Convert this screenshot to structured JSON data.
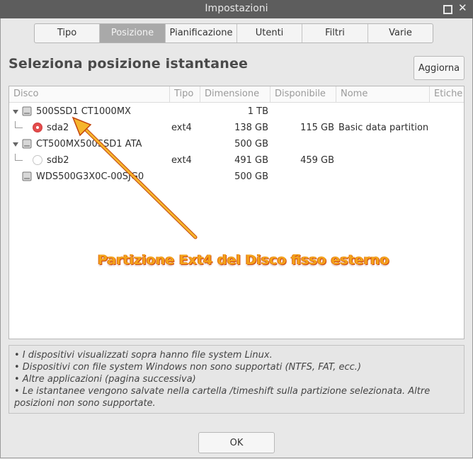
{
  "window": {
    "title": "Impostazioni"
  },
  "tabs": [
    {
      "label": "Tipo"
    },
    {
      "label": "Posizione"
    },
    {
      "label": "Pianificazione"
    },
    {
      "label": "Utenti"
    },
    {
      "label": "Filtri"
    },
    {
      "label": "Varie"
    }
  ],
  "active_tab": "Posizione",
  "heading": "Seleziona posizione istantanee",
  "refresh_button": "Aggiorna",
  "table": {
    "columns": [
      "Disco",
      "Tipo",
      "Dimensione",
      "Disponibile",
      "Nome",
      "Etiche"
    ],
    "rows": [
      {
        "disco": "500SSD1 CT1000MX",
        "tipo": "",
        "dimensione": "1 TB",
        "disponibile": "",
        "nome": "",
        "kind": "disk",
        "expanded": true
      },
      {
        "disco": "sda2",
        "tipo": "ext4",
        "dimensione": "138 GB",
        "disponibile": "115 GB",
        "nome": "Basic data partition",
        "kind": "partition",
        "selected": true
      },
      {
        "disco": "CT500MX500SSD1 ATA",
        "tipo": "",
        "dimensione": "500 GB",
        "disponibile": "",
        "nome": "",
        "kind": "disk",
        "expanded": true
      },
      {
        "disco": "sdb2",
        "tipo": "ext4",
        "dimensione": "491 GB",
        "disponibile": "459 GB",
        "nome": "",
        "kind": "partition",
        "selected": false
      },
      {
        "disco": "WDS500G3X0C-00SJG0",
        "tipo": "",
        "dimensione": "500 GB",
        "disponibile": "",
        "nome": "",
        "kind": "disk",
        "expanded": false
      }
    ]
  },
  "annotation": "Partizione Ext4 del Disco fisso esterno",
  "notes": [
    "• I dispositivi visualizzati sopra hanno file system Linux.",
    "• Dispositivi con file system Windows non sono supportati (NTFS, FAT, ecc.)",
    "• Altre applicazioni (pagina successiva)",
    "• Le istantanee vengono salvate nella cartella /timeshift sulla partizione selezionata. Altre posizioni non sono supportate."
  ],
  "ok_button": "OK",
  "colors": {
    "selected_radio": "#e34c4c",
    "annotation_text": "#f3a21a",
    "active_tab_bg": "#a9a9a9"
  },
  "icons": {
    "disk": "hard-disk-icon",
    "max": "maximize-icon",
    "close": "close-icon"
  }
}
